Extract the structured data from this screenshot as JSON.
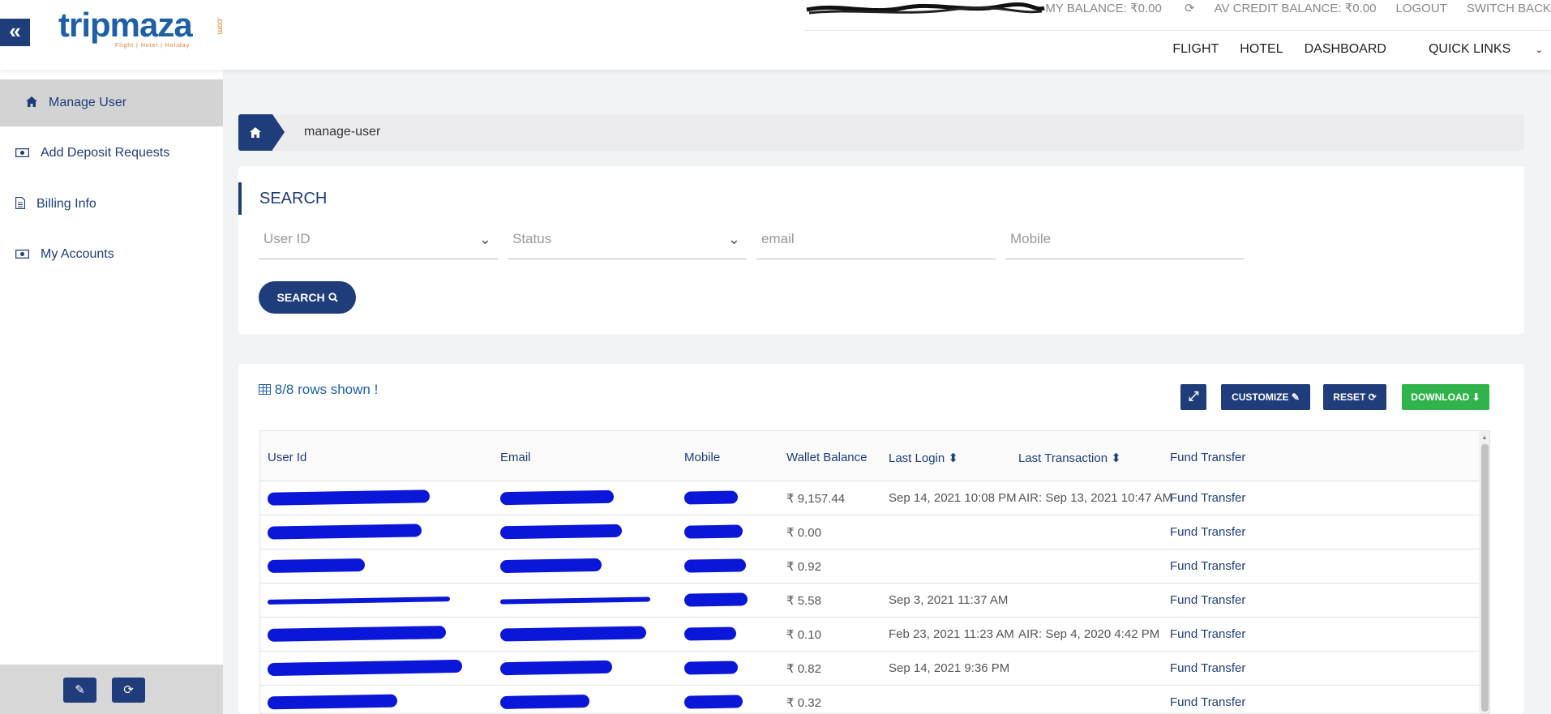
{
  "header": {
    "logo": {
      "mark": "tripmaza",
      "first_letter": "t",
      "rest": "ripmaza",
      "com": ".com",
      "tagline": "Flight | Hotel | Holiday"
    },
    "top_links": {
      "my_balance": "MY BALANCE: ₹0.00",
      "av_credit_balance": "AV CREDIT BALANCE: ₹0.00",
      "logout": "LOGOUT",
      "switch_back": "SWITCH BACK"
    },
    "nav": {
      "flight": "FLIGHT",
      "hotel": "HOTEL",
      "dashboard": "DASHBOARD",
      "quick_links": "QUICK LINKS"
    }
  },
  "sidebar": {
    "items": [
      {
        "label": "Manage User",
        "icon": "home-icon"
      },
      {
        "label": "Add Deposit Requests",
        "icon": "money-icon"
      },
      {
        "label": "Billing Info",
        "icon": "document-icon"
      },
      {
        "label": "My Accounts",
        "icon": "money-icon"
      }
    ]
  },
  "breadcrumb": {
    "current": "manage-user"
  },
  "search": {
    "title": "SEARCH",
    "user_id_placeholder": "User ID",
    "status_placeholder": "Status",
    "email_placeholder": "email",
    "mobile_placeholder": "Mobile",
    "button_label": "SEARCH"
  },
  "table": {
    "rows_shown": "8/8 rows shown !",
    "buttons": {
      "customize": "CUSTOMIZE",
      "reset": "RESET",
      "download": "DOWNLOAD"
    },
    "headers": [
      "User Id",
      "Email",
      "Mobile",
      "Wallet Balance",
      "Last Login",
      "Last Transaction",
      "Fund Transfer"
    ],
    "rows": [
      {
        "wallet": "₹ 9,157.44",
        "last_login": "Sep 14, 2021 10:08 PM",
        "last_txn": "AIR: Sep 13, 2021 10:47 AM",
        "fund": "Fund Transfer"
      },
      {
        "wallet": "₹ 0.00",
        "last_login": "",
        "last_txn": "",
        "fund": "Fund Transfer"
      },
      {
        "wallet": "₹ 0.92",
        "last_login": "",
        "last_txn": "",
        "fund": "Fund Transfer"
      },
      {
        "wallet": "₹ 5.58",
        "last_login": "Sep 3, 2021 11:37 AM",
        "last_txn": "",
        "fund": "Fund Transfer"
      },
      {
        "wallet": "₹ 0.10",
        "last_login": "Feb 23, 2021 11:23 AM",
        "last_txn": "AIR: Sep 4, 2020 4:42 PM",
        "fund": "Fund Transfer"
      },
      {
        "wallet": "₹ 0.82",
        "last_login": "Sep 14, 2021 9:36 PM",
        "last_txn": "",
        "fund": "Fund Transfer"
      },
      {
        "wallet": "₹ 0.32",
        "last_login": "",
        "last_txn": "",
        "fund": "Fund Transfer"
      }
    ]
  },
  "colors": {
    "primary": "#1f3d7a",
    "accent_link": "#1f5fa8",
    "download": "#2fb34a",
    "redaction": "#0a17d8"
  }
}
